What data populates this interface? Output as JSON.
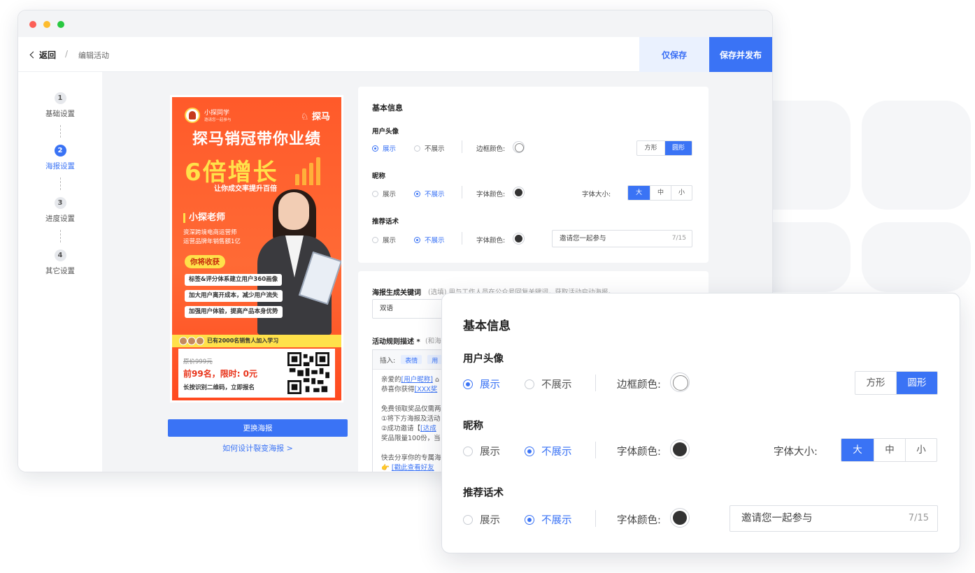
{
  "header": {
    "back_label": "返回",
    "separator": "/",
    "breadcrumb": "编辑活动",
    "save_only_label": "仅保存",
    "save_publish_label": "保存并发布"
  },
  "steps": [
    {
      "num": "1",
      "label": "基础设置",
      "active": false
    },
    {
      "num": "2",
      "label": "海报设置",
      "active": true
    },
    {
      "num": "3",
      "label": "进度设置",
      "active": false
    },
    {
      "num": "4",
      "label": "其它设置",
      "active": false
    }
  ],
  "poster": {
    "user_name": "小探同学",
    "invite_text": "邀请您一起参与",
    "brand": "探马",
    "title": "探马销冠带你业绩",
    "big_text": "6倍增长",
    "subtitle": "让你成交率提升百倍",
    "teacher": "小探老师",
    "teacher_desc_1": "资深跨境电商运营师",
    "teacher_desc_2": "运营品牌年销售额1亿",
    "gain_title": "你将收获",
    "gains": [
      "标签&评分体系建立用户360画像",
      "加大用户离开成本，减少用户流失",
      "加强用户体验，提高产品本身优势"
    ],
    "join_text": "已有2000名销售人加入学习",
    "original_price": "原价999元",
    "limit_text": "前99名，限时: 0元",
    "scan_text": "长按识别二维码，立即报名"
  },
  "poster_actions": {
    "change_label": "更换海报",
    "design_link": "如何设计裂变海报 >"
  },
  "basic_info": {
    "title": "基本信息",
    "avatar_label": "用户头像",
    "nickname_label": "昵称",
    "pitch_label": "推荐话术",
    "show_label": "展示",
    "hide_label": "不展示",
    "border_color_label": "边框颜色:",
    "font_color_label": "字体颜色:",
    "font_size_label": "字体大小:",
    "shape_square": "方形",
    "shape_round": "圆形",
    "size_large": "大",
    "size_medium": "中",
    "size_small": "小",
    "pitch_value": "邀请您一起参与",
    "pitch_count": "7/15"
  },
  "keyword": {
    "label": "海报生成关键词",
    "hint": "(选填)  用与工作人员在公众号回复关键词，获取活动启动海报。",
    "value": "双语"
  },
  "rules": {
    "label": "活动规则描述 *",
    "hint": "(和海",
    "insert_label": "插入:",
    "tag_emoji": "表情",
    "tag_user": "用",
    "line1_pre": "亲爱的",
    "line1_link": "[用户昵称]",
    "line1_post": " ⌂",
    "line2_pre": "恭喜你获得",
    "line2_link": "[XXX奖",
    "line3": "免费领取奖品仅需两",
    "line4": "①将下方海报及活动",
    "line5_pre": "②成功邀请【",
    "line5_link": "[达成",
    "line6": "奖品限量100份，当",
    "line7": "快去分享你的专属海",
    "line8_link": "[戳此查看好友"
  },
  "colors": {
    "accent": "#3a73f5",
    "poster_red": "#ff5a2a",
    "poster_yellow": "#ffe14a"
  }
}
